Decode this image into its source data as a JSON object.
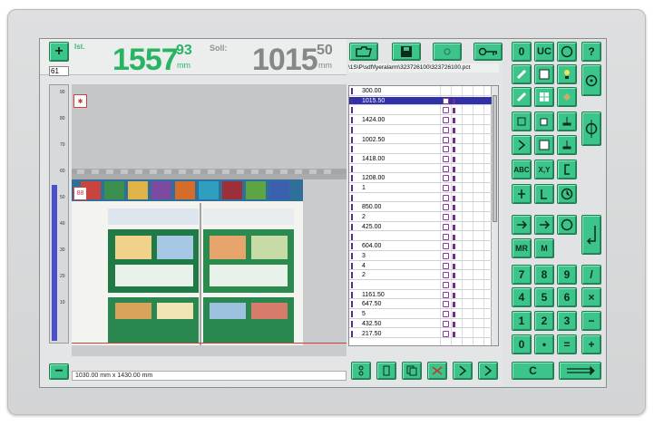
{
  "measure": {
    "ist_label": "Ist.",
    "ist_main": "1557",
    "ist_decimal": "93",
    "ist_unit": "mm",
    "soll_label": "Soll:",
    "soll_main": "1015",
    "soll_decimal": "50",
    "soll_unit": "mm"
  },
  "counter": "61",
  "file_path": "\\1S\\P\\sdf\\fyeralarm\\323726100\\323726100.pct",
  "dimensions": "1030.00 mm x 1430.00 mm",
  "ruler_ticks": [
    "90",
    "80",
    "70",
    "60",
    "50",
    "40",
    "30",
    "20",
    "10"
  ],
  "cut_list": [
    {
      "value": "300.00",
      "selected": false
    },
    {
      "value": "1015.50",
      "selected": true
    },
    {
      "value": "",
      "selected": false
    },
    {
      "value": "1424.00",
      "selected": false
    },
    {
      "value": "",
      "selected": false
    },
    {
      "value": "1002.50",
      "selected": false
    },
    {
      "value": "",
      "selected": false
    },
    {
      "value": "1418.00",
      "selected": false
    },
    {
      "value": "",
      "selected": false
    },
    {
      "value": "1208.00",
      "selected": false
    },
    {
      "value": "1",
      "selected": false
    },
    {
      "value": "",
      "selected": false
    },
    {
      "value": "850.00",
      "selected": false
    },
    {
      "value": "2",
      "selected": false
    },
    {
      "value": "425.00",
      "selected": false
    },
    {
      "value": "",
      "selected": false
    },
    {
      "value": "604.00",
      "selected": false
    },
    {
      "value": "3",
      "selected": false
    },
    {
      "value": "4",
      "selected": false
    },
    {
      "value": "2",
      "selected": false
    },
    {
      "value": "",
      "selected": false
    },
    {
      "value": "1161.50",
      "selected": false
    },
    {
      "value": "647.50",
      "selected": false
    },
    {
      "value": "5",
      "selected": false
    },
    {
      "value": "432.50",
      "selected": false
    },
    {
      "value": "217.50",
      "selected": false
    }
  ],
  "keypad": {
    "zero": "0",
    "uc": "UC",
    "help": "?",
    "abc": "ABC",
    "xy": "X,Y",
    "mr": "MR",
    "m": "M",
    "k7": "7",
    "k8": "8",
    "k9": "9",
    "div": "/",
    "k4": "4",
    "k5": "5",
    "k6": "6",
    "mul": "×",
    "k1": "1",
    "k2": "2",
    "k3": "3",
    "minus": "−",
    "k0": "0",
    "dot": "•",
    "eq": "=",
    "plus": "+",
    "clear": "C",
    "plus_left": "+",
    "minus_left": "−"
  },
  "colors": {
    "accent_green": "#3cc58b",
    "ist_green": "#27b564",
    "selection_blue": "#3030a8"
  }
}
